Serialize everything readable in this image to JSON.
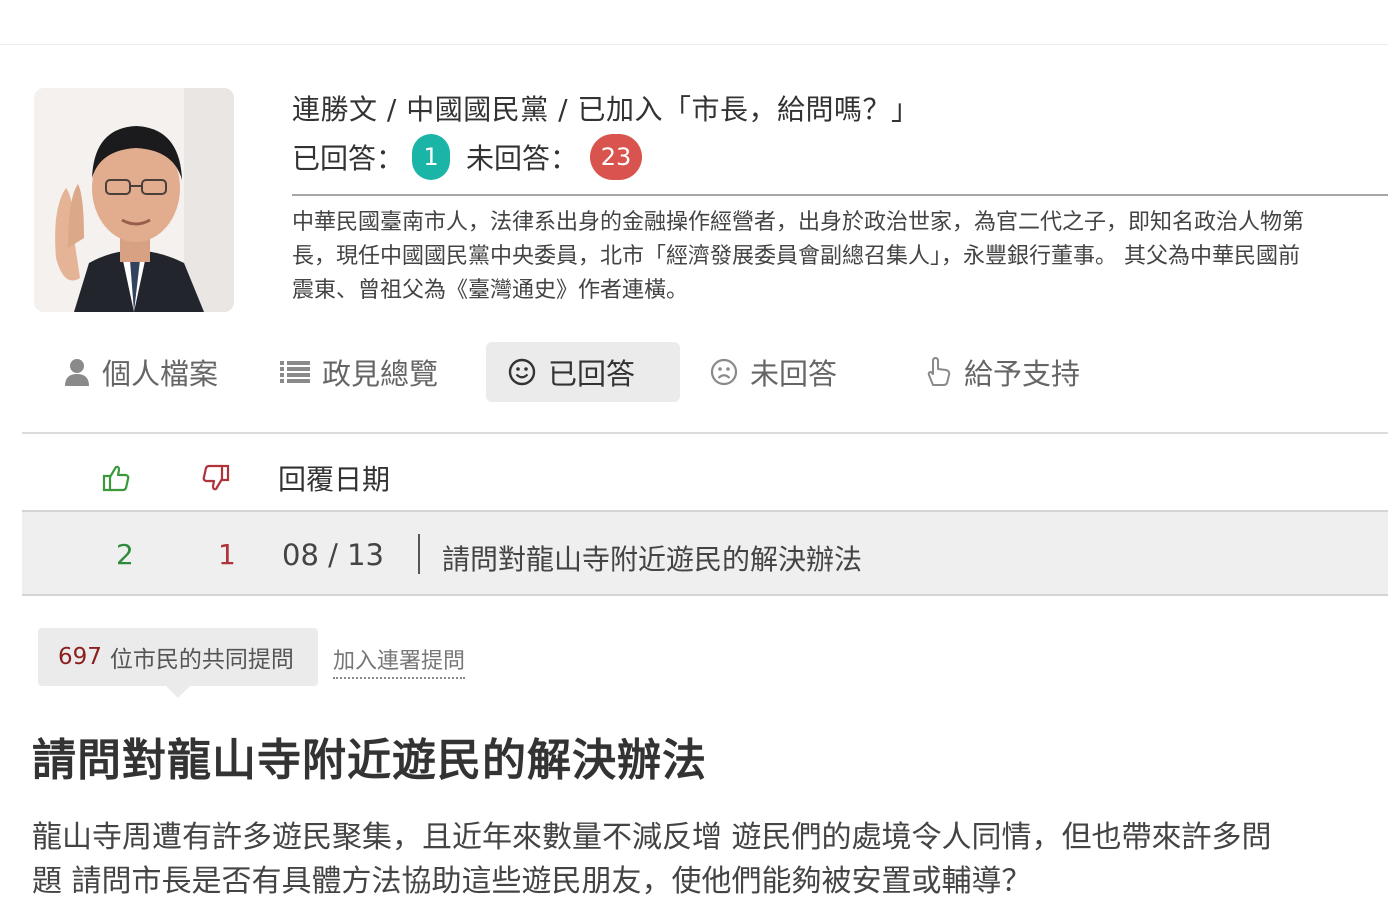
{
  "candidate": {
    "heading": "連勝文 / 中國國民黨 / 已加入「市長，給問嗎？」",
    "answered_label": "已回答：",
    "answered_count": "1",
    "unanswered_label": "未回答：",
    "unanswered_count": "23",
    "bio_lines": [
      "中華民國臺南市人，法律系出身的金融操作經營者，出身於政治世家，為官二代之子，即知名政治人物第",
      "長，現任中國國民黨中央委員，北市「經濟發展委員會副總召集人」，永豐銀行董事。 其父為中華民國前",
      "震東、曾祖父為《臺灣通史》作者連橫。"
    ]
  },
  "tabs": [
    {
      "label": "個人檔案",
      "icon": "user-icon"
    },
    {
      "label": "政見總覽",
      "icon": "list-icon"
    },
    {
      "label": "已回答",
      "icon": "smile-icon",
      "active": true
    },
    {
      "label": "未回答",
      "icon": "frown-icon"
    },
    {
      "label": "給予支持",
      "icon": "pointer-hand-icon"
    }
  ],
  "table": {
    "header_date": "回覆日期",
    "row": {
      "likes": "2",
      "dislikes": "1",
      "date": "08 / 13",
      "title": "請問對龍山寺附近遊民的解決辦法"
    }
  },
  "petition": {
    "cosign_count": "697",
    "cosign_text": "位市民的共同提問",
    "join_label": "加入連署提問",
    "title": "請問對龍山寺附近遊民的解決辦法",
    "body_lines": [
      "龍山寺周遭有許多遊民聚集，且近年來數量不減反增 遊民們的處境令人同情，但也帶來許多問",
      "題 請問市長是否有具體方法協助這些遊民朋友，使他們能夠被安置或輔導？"
    ]
  },
  "colors": {
    "answered_badge": "#1ab5a7",
    "unanswered_badge": "#d9534f",
    "like_green": "#2e8b3e",
    "dislike_red": "#b0323a"
  }
}
